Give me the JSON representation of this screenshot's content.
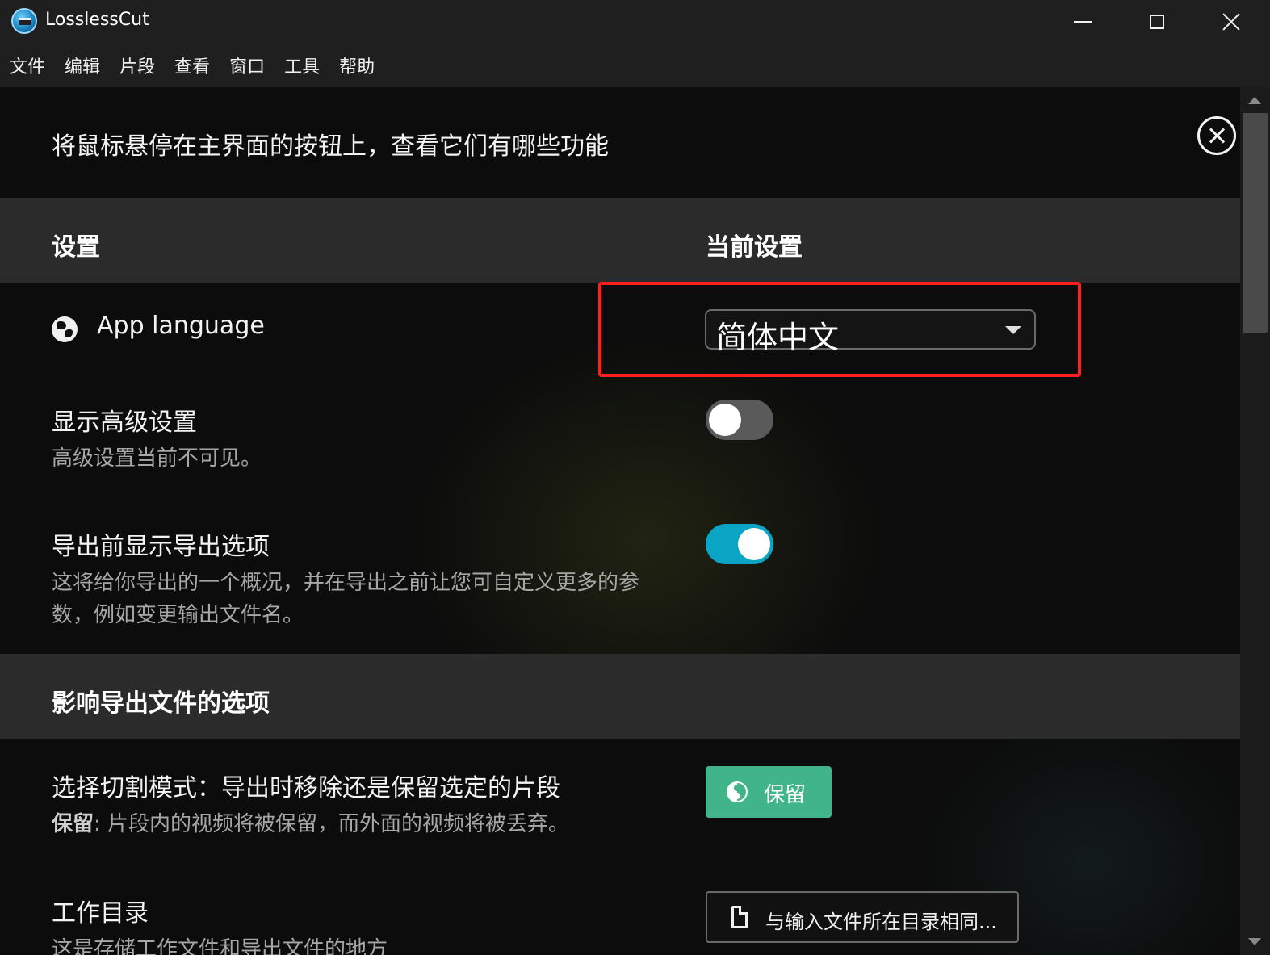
{
  "window": {
    "title": "LosslessCut",
    "icons": {
      "app": "lossless-cut-logo-icon",
      "minimize": "minimize-icon",
      "maximize": "maximize-icon",
      "close": "close-icon"
    }
  },
  "menu": [
    "文件",
    "编辑",
    "片段",
    "查看",
    "窗口",
    "工具",
    "帮助"
  ],
  "settings": {
    "hint": "将鼠标悬停在主界面的按钮上，查看它们有哪些功能",
    "close_icon": "close-circle-icon",
    "header": {
      "setting": "设置",
      "current": "当前设置"
    },
    "app_language": {
      "label": "App language",
      "icon": "globe-icon",
      "value": "简体中文"
    },
    "advanced": {
      "title": "显示高级设置",
      "desc": "高级设置当前不可见。",
      "enabled": false
    },
    "export_options": {
      "title": "导出前显示导出选项",
      "desc": "这将给你导出的一个概况，并在导出之前让您可自定义更多的参数，例如变更输出文件名。",
      "enabled": true
    },
    "section2": "影响导出文件的选项",
    "cut_mode": {
      "title": "选择切割模式：导出时移除还是保留选定的片段",
      "desc_strong": "保留",
      "desc": ": 片段内的视频将被保留，而外面的视频将被丢弃。",
      "button": "保留",
      "icon": "yin-yang-icon"
    },
    "work_dir": {
      "title": "工作目录",
      "desc": "这是存储工作文件和导出文件的地方",
      "button": "与输入文件所在目录相同...",
      "icon": "file-icon"
    }
  },
  "colors": {
    "accent_toggle": "#0aa5c4",
    "keep_button": "#41b48a",
    "highlight": "#ff1f1f"
  }
}
